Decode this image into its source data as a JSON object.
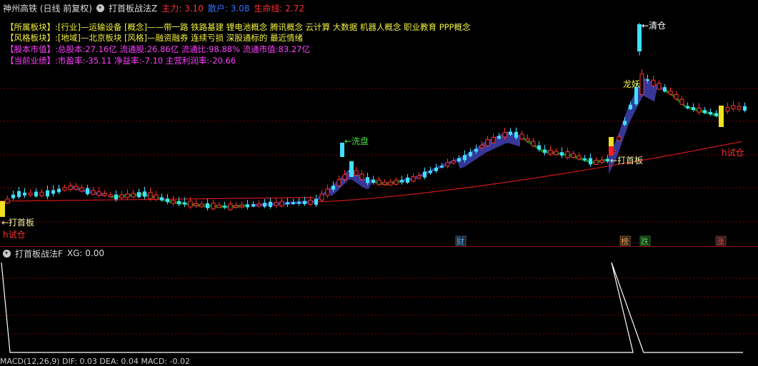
{
  "header": {
    "stock_title": "神州高铁 (日线 前复权)",
    "indicator_name": "打首板战法Z",
    "metrics": [
      {
        "label": "主力:",
        "value": "3.10",
        "color": "#ff3030"
      },
      {
        "label": "散户:",
        "value": "3.08",
        "color": "#3070ff"
      },
      {
        "label": "生命线:",
        "value": "2.72",
        "color": "#ff3030"
      }
    ]
  },
  "info_lines": [
    {
      "key": "【所属板块】:",
      "value": "[行业]—运输设备 [概念]——带一路 铁路基建 锂电池概念 腾讯概念 云计算 大数据 机器人概念 职业教育 PPP概念",
      "style": "yellow"
    },
    {
      "key": "【风格板块】:",
      "value": "[地域]—北京板块 [风格]—融资融券 连续亏损 深股通标的 最近情绪",
      "style": "yellow"
    },
    {
      "key": "【股本市值】:",
      "value": "总股本:27.16亿 流通股:26.86亿 流通比:98.88% 流通市值:83.27亿",
      "style": "magenta"
    },
    {
      "key": "【当前业绩】:",
      "value": "市盈率:-35.11 净益率:-7.10 主营利润率:-20.66",
      "style": "magenta"
    }
  ],
  "annotations": {
    "qingcang": "←清仓",
    "longyao": "龙妖",
    "xipan": "←洗盘",
    "dashouban_left": "←打首板",
    "dashouban_right": "←打首板",
    "shicang_left": "h试仓",
    "shicang_right": "h试仓"
  },
  "event_badges": [
    {
      "text": "财",
      "color": "#5ab0ff"
    },
    {
      "text": "榜",
      "color": "#ffa040"
    },
    {
      "text": "跌",
      "color": "#40e040"
    },
    {
      "text": "涨",
      "color": "#ff4040"
    }
  ],
  "sub_panel": {
    "title": "打首板战法F",
    "series_label": "XG:",
    "series_value": "0.00"
  },
  "bottom_line": "MACD(12,26,9) DIF: 0.03 DEA: 0.04 MACD: -0.02",
  "colors": {
    "up": "#ff3030",
    "down": "#40e0ff",
    "band_up": "#3a3aa0",
    "band_down": "#0d7a0d",
    "lifeline": "#d01818",
    "grid": "#7a0000"
  },
  "chart_data": {
    "type": "candlestick",
    "series": [
      {
        "name": "主力",
        "last": 3.1
      },
      {
        "name": "散户",
        "last": 3.08
      },
      {
        "name": "生命线",
        "last": 2.72
      }
    ],
    "indicator": {
      "name": "XG",
      "values": [
        1,
        0,
        0,
        0,
        0,
        0,
        0,
        0,
        0,
        0,
        0,
        0,
        0,
        0,
        0,
        0,
        0,
        0,
        0,
        0,
        0,
        0,
        0,
        0,
        0,
        0,
        0,
        0,
        0,
        0,
        0,
        0,
        0,
        0,
        0,
        0,
        0,
        0,
        0,
        0,
        0,
        0,
        0,
        0,
        0,
        0,
        0,
        0,
        0,
        0,
        0,
        0,
        0,
        0,
        0,
        0,
        0,
        0,
        0,
        0,
        0,
        0,
        0,
        0,
        0,
        0,
        0,
        0,
        0,
        0,
        0,
        0,
        0,
        0,
        0,
        0,
        0,
        0,
        0,
        0,
        0,
        0,
        0,
        0,
        0,
        0,
        0,
        0,
        0,
        0,
        0,
        0,
        0,
        0,
        0,
        0,
        0,
        0,
        0,
        0,
        0,
        0,
        0,
        0,
        0,
        0,
        0,
        0,
        0,
        0,
        0,
        0,
        0,
        0,
        0,
        0,
        0,
        0,
        0,
        0,
        0,
        1,
        0,
        0,
        0,
        0,
        0,
        0,
        0,
        0,
        0,
        0,
        0,
        0,
        0,
        0,
        0,
        0,
        0,
        0,
        0,
        0
      ]
    }
  }
}
